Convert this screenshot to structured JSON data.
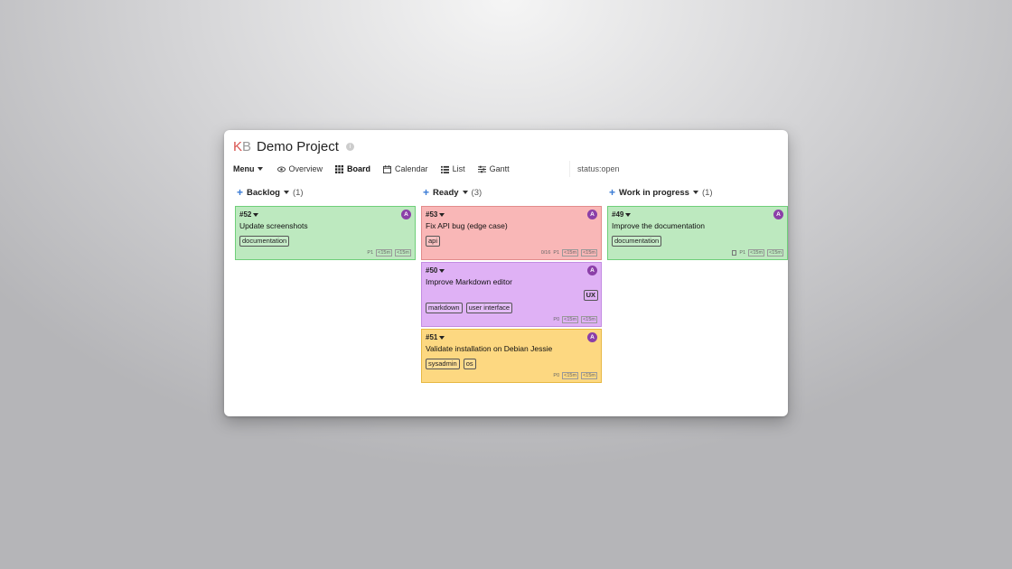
{
  "header": {
    "logo_k": "K",
    "logo_b": "B",
    "project_name": "Demo Project",
    "info_icon": "info-icon"
  },
  "toolbar": {
    "menu_label": "Menu",
    "views": [
      {
        "label": "Overview",
        "icon": "eye-icon",
        "active": false
      },
      {
        "label": "Board",
        "icon": "grid-icon",
        "active": true
      },
      {
        "label": "Calendar",
        "icon": "calendar-icon",
        "active": false
      },
      {
        "label": "List",
        "icon": "list-icon",
        "active": false
      },
      {
        "label": "Gantt",
        "icon": "gantt-icon",
        "active": false
      }
    ],
    "search_value": "status:open"
  },
  "colors": {
    "green": "#bde9bf",
    "red": "#f9b7b7",
    "purple": "#dfb1f5",
    "yellow": "#fdd881",
    "avatar": "#8b3fa8",
    "plus": "#3a7bd5",
    "logo": "#d9534f"
  },
  "columns": [
    {
      "title": "Backlog",
      "count": "(1)",
      "cards": [
        {
          "id": "#52",
          "title": "Update screenshots",
          "tags": [
            "documentation"
          ],
          "avatar": "A",
          "priority": "P1",
          "est1": "<15m",
          "est2": "<15m"
        }
      ]
    },
    {
      "title": "Ready",
      "count": "(3)",
      "cards": [
        {
          "id": "#53",
          "title": "Fix API bug (edge case)",
          "tags": [
            "api"
          ],
          "avatar": "A",
          "subtasks": "0/16",
          "priority": "P1",
          "est1": "<15m",
          "est2": "<15m"
        },
        {
          "id": "#50",
          "title": "Improve Markdown editor",
          "tags": [
            "markdown",
            "user interface"
          ],
          "badge": "UX",
          "avatar": "A",
          "priority": "P0",
          "est1": "<15m",
          "est2": "<15m"
        },
        {
          "id": "#51",
          "title": "Validate installation on Debian Jessie",
          "tags": [
            "sysadmin",
            "os"
          ],
          "avatar": "A",
          "priority": "P0",
          "est1": "<15m",
          "est2": "<15m"
        }
      ]
    },
    {
      "title": "Work in progress",
      "count": "(1)",
      "cards": [
        {
          "id": "#49",
          "title": "Improve the documentation",
          "tags": [
            "documentation"
          ],
          "avatar": "A",
          "priority": "P1",
          "est1": "<15m",
          "est2": "<15m"
        }
      ]
    }
  ]
}
